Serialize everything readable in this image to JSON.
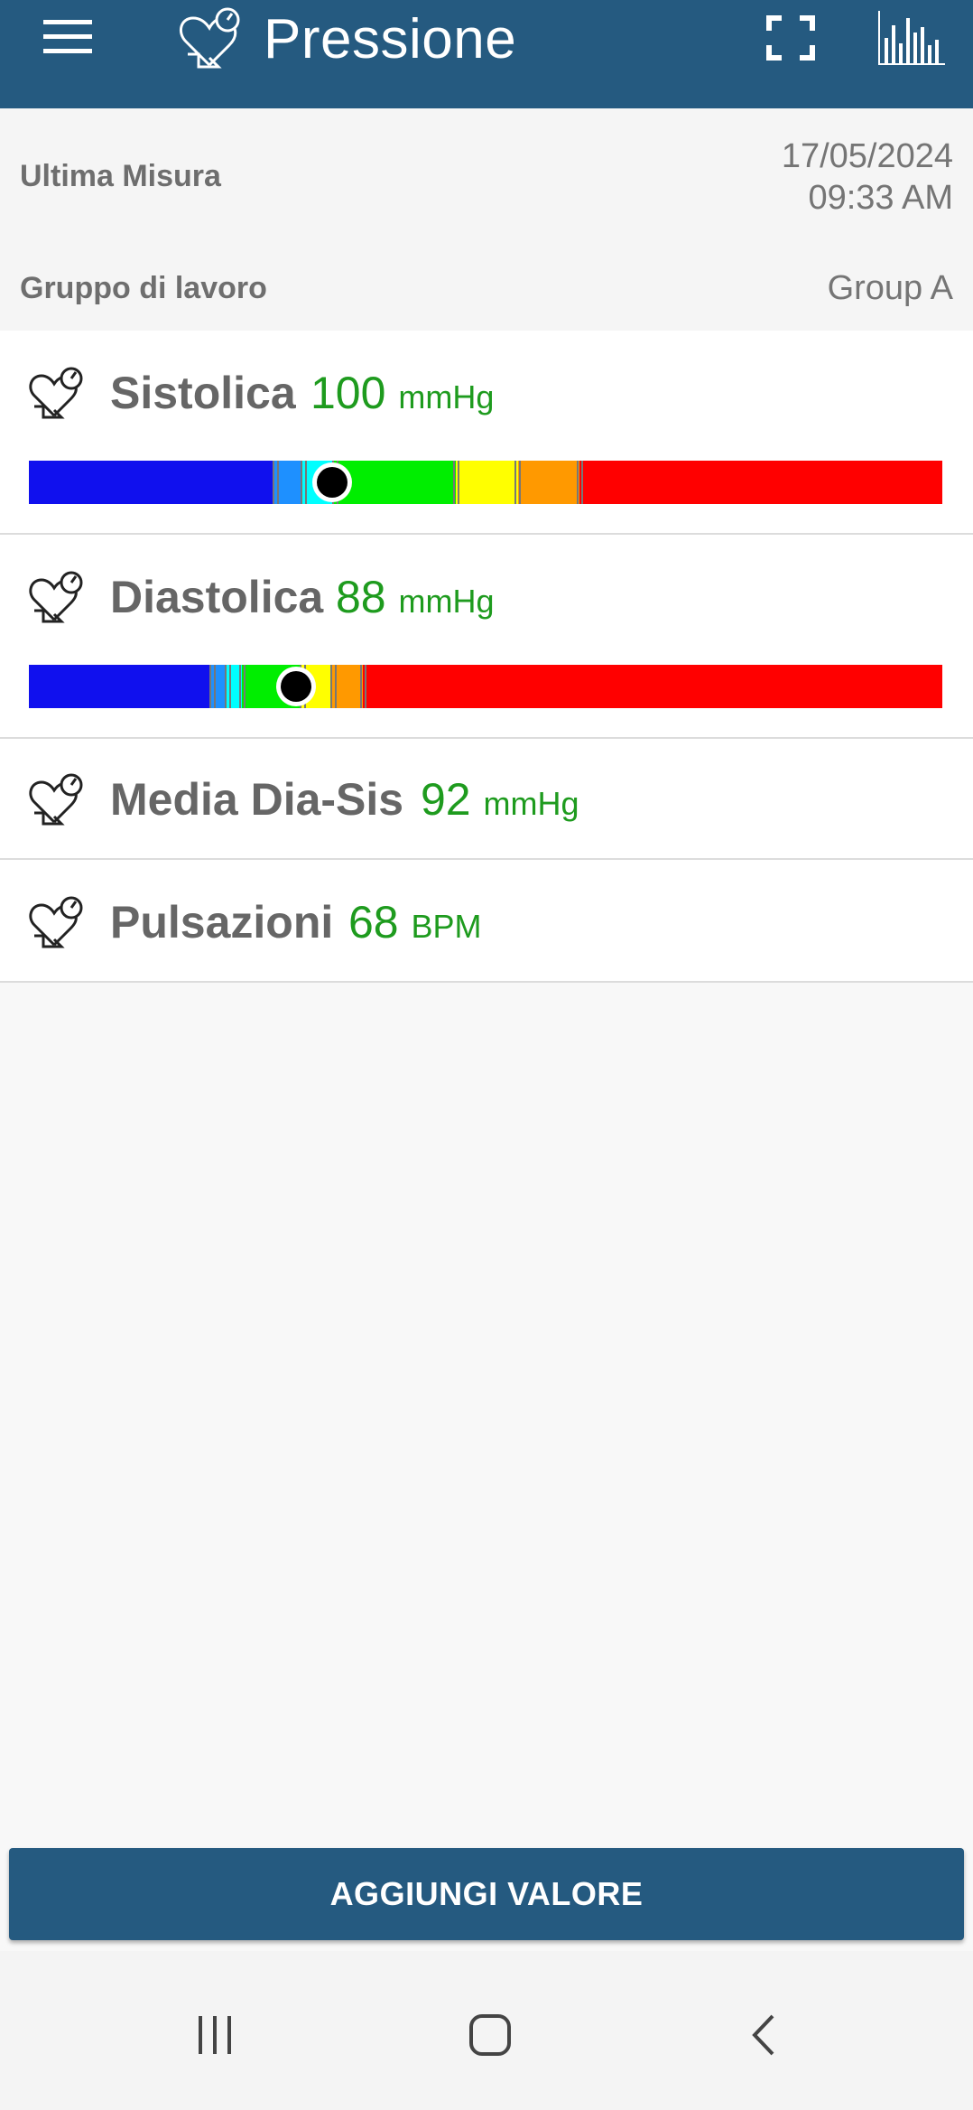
{
  "app_bar": {
    "title": "Pressione",
    "background": "#255a80",
    "icons": [
      "hamburger-menu-icon",
      "heart-gauge-icon",
      "fullscreen-icon",
      "bar-chart-icon"
    ]
  },
  "info": {
    "last_measure_label": "Ultima Misura",
    "date": "17/05/2024",
    "time": "09:33 AM",
    "group_label": "Gruppo di lavoro",
    "group_value": "Group A"
  },
  "measures": {
    "systolic": {
      "label": "Sistolica",
      "value": "100",
      "unit": "mmHg"
    },
    "diastolic": {
      "label": "Diastolica",
      "value": "88",
      "unit": "mmHg"
    },
    "mean": {
      "label": "Media Dia-Sis",
      "value": "92",
      "unit": "mmHg"
    },
    "pulse": {
      "label": "Pulsazioni",
      "value": "68",
      "unit": "BPM"
    }
  },
  "scales": {
    "colors": [
      "#1010ee",
      "#1e90ff",
      "#00ffff",
      "#00ee00",
      "#ffff00",
      "#ff9900",
      "#ff0000"
    ],
    "systolic_marker_fraction": 0.332,
    "diastolic_marker_fraction": 0.292
  },
  "action_button": {
    "label": "AGGIUNGI VALORE",
    "background": "#255a80"
  },
  "system_nav": {
    "icons": [
      "recent-apps-icon",
      "home-icon",
      "back-icon"
    ]
  }
}
